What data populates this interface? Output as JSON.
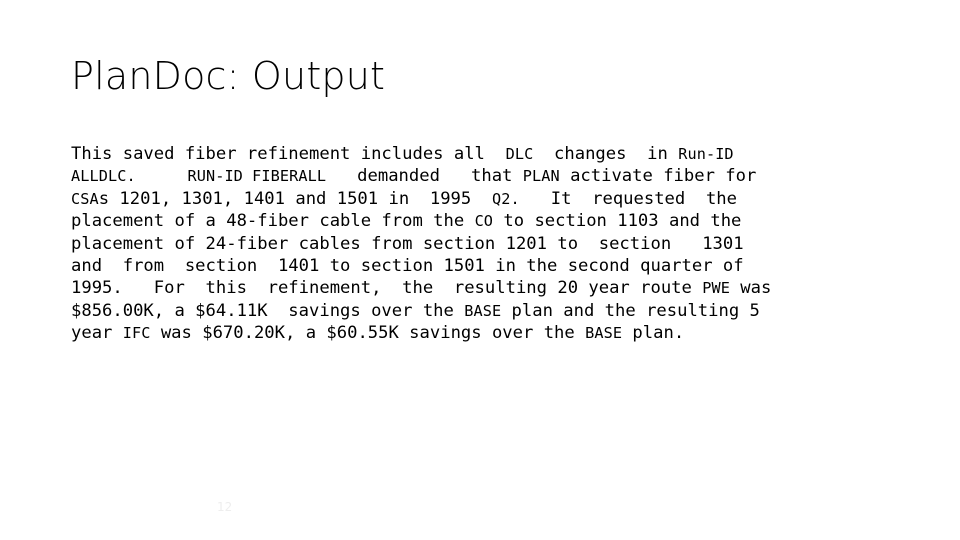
{
  "slide": {
    "title": "PlanDoc: Output",
    "page_number": "12",
    "background_color": "#ffffff",
    "text_color": "#000000",
    "page_number_color": "#eeeeee",
    "body_paragraph": "This saved fiber refinement includes all  DLC  changes  in Run-ID ALLDLC.    RUN-ID FIBERALL   demanded   that PLAN activate fiber for CSAs 1201, 1301, 1401 and 1501 in  1995  Q2.   It  requested  the placement of a 48-fiber cable from the CO to section 1103 and the placement of 24-fiber cables from section 1201 to  section   1301 and  from  section  1401 to section 1501 in the second quarter of 1995.   For  this  refinement,  the  resulting 20 year route PWE was $856.00K, a $64.11K  savings over the BASE plan and the resulting 5 year IFC was $670.20K, a $60.55K savings over the BASE plan.",
    "body_lines": [
      {
        "segments": [
          {
            "text": "This saved fiber refinement includes all  ",
            "style": "normal"
          },
          {
            "text": "DLC",
            "style": "acronym"
          },
          {
            "text": "  changes  in ",
            "style": "normal"
          },
          {
            "text": "Run-ID",
            "style": "acronym"
          }
        ]
      },
      {
        "segments": [
          {
            "text": "ALLDLC.",
            "style": "acronym"
          },
          {
            "text": "     ",
            "style": "normal"
          },
          {
            "text": "RUN-ID FIBERALL",
            "style": "acronym"
          },
          {
            "text": "   demanded   that ",
            "style": "normal"
          },
          {
            "text": "PLAN",
            "style": "acronym"
          },
          {
            "text": " activate fiber for",
            "style": "normal"
          }
        ]
      },
      {
        "segments": [
          {
            "text": "CSA",
            "style": "acronym"
          },
          {
            "text": "s 1201, 1301, 1401 and 1501 in  1995  ",
            "style": "normal"
          },
          {
            "text": "Q2.",
            "style": "acronym"
          },
          {
            "text": "   It  requested  the",
            "style": "normal"
          }
        ]
      },
      {
        "segments": [
          {
            "text": "placement of a 48-fiber cable from the ",
            "style": "normal"
          },
          {
            "text": "CO",
            "style": "acronym"
          },
          {
            "text": " to section 1103 and the",
            "style": "normal"
          }
        ]
      },
      {
        "segments": [
          {
            "text": "placement of 24-fiber cables from section 1201 to  section   1301",
            "style": "normal"
          }
        ]
      },
      {
        "segments": [
          {
            "text": "and  from  section  1401 to section 1501 in the second quarter of",
            "style": "normal"
          }
        ]
      },
      {
        "segments": [
          {
            "text": "1995.   For  this  refinement,  the  resulting 20 year route ",
            "style": "normal"
          },
          {
            "text": "PWE",
            "style": "acronym"
          },
          {
            "text": " was",
            "style": "normal"
          }
        ]
      },
      {
        "segments": [
          {
            "text": "$856.00K, a $64.11K  savings over the ",
            "style": "normal"
          },
          {
            "text": "BASE",
            "style": "acronym"
          },
          {
            "text": " plan and the resulting 5",
            "style": "normal"
          }
        ]
      },
      {
        "segments": [
          {
            "text": "year ",
            "style": "normal"
          },
          {
            "text": "IFC",
            "style": "acronym"
          },
          {
            "text": " was $670.20K, a $60.55K savings over the ",
            "style": "normal"
          },
          {
            "text": "BASE",
            "style": "acronym"
          },
          {
            "text": " plan.",
            "style": "normal"
          }
        ]
      }
    ]
  }
}
